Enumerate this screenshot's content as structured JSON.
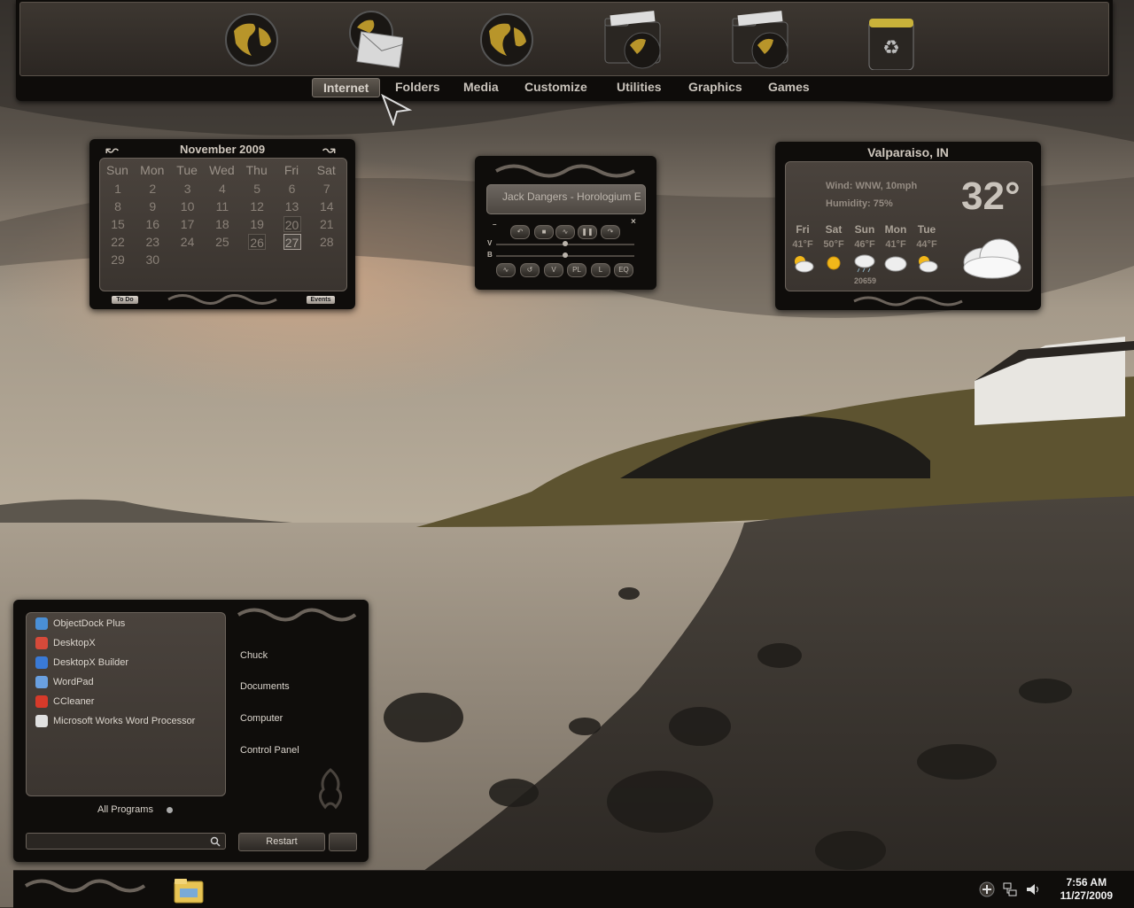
{
  "dock": {
    "tabs": [
      {
        "label": "Internet",
        "active": true
      },
      {
        "label": "Folders"
      },
      {
        "label": "Media"
      },
      {
        "label": "Customize"
      },
      {
        "label": "Utilities"
      },
      {
        "label": "Graphics"
      },
      {
        "label": "Games"
      }
    ],
    "icons": [
      "globe-icon",
      "mail-icon",
      "globe-icon",
      "folder-globe-icon",
      "folder-globe-icon",
      "recycle-bin-icon"
    ]
  },
  "calendar": {
    "month_title": "November 2009",
    "weekdays": [
      "Sun",
      "Mon",
      "Tue",
      "Wed",
      "Thu",
      "Fri",
      "Sat"
    ],
    "weeks": [
      [
        "1",
        "2",
        "3",
        "4",
        "5",
        "6",
        "7"
      ],
      [
        "8",
        "9",
        "10",
        "11",
        "12",
        "13",
        "14"
      ],
      [
        "15",
        "16",
        "17",
        "18",
        "19",
        "20",
        "21"
      ],
      [
        "22",
        "23",
        "24",
        "25",
        "26",
        "27",
        "28"
      ],
      [
        "29",
        "30"
      ]
    ],
    "boxed_days": [
      "20",
      "26"
    ],
    "today": "27",
    "todo_label": "To Do",
    "events_label": "Events"
  },
  "player": {
    "track": "Jack Dangers - Horologium E",
    "v_label": "V",
    "b_label": "B",
    "close_label": "×",
    "min_label": "–",
    "buttons_row2": [
      "V",
      "PL",
      "L",
      "EQ"
    ],
    "volume": 0.5,
    "balance": 0.5
  },
  "weather": {
    "city": "Valparaiso, IN",
    "wind": "Wind: WNW, 10mph",
    "humidity": "Humidity: 75%",
    "temp": "32°",
    "forecast": [
      {
        "day": "Fri",
        "hi": "41°F",
        "icon": "partly-cloudy-icon"
      },
      {
        "day": "Sat",
        "hi": "50°F",
        "icon": "sunny-icon"
      },
      {
        "day": "Sun",
        "hi": "46°F",
        "icon": "rain-cloud-icon"
      },
      {
        "day": "Mon",
        "hi": "41°F",
        "icon": "cloudy-icon"
      },
      {
        "day": "Tue",
        "hi": "44°F",
        "icon": "partly-cloudy-icon"
      }
    ],
    "zip": "20659",
    "current_icon": "cloudy-icon"
  },
  "startmenu": {
    "programs": [
      {
        "label": "ObjectDock Plus",
        "color": "#4a8fd6"
      },
      {
        "label": "DesktopX",
        "color": "#d64a3a"
      },
      {
        "label": "DesktopX Builder",
        "color": "#3a7ad6"
      },
      {
        "label": "WordPad",
        "color": "#6aa0e0"
      },
      {
        "label": "CCleaner",
        "color": "#d63a2a"
      },
      {
        "label": "Microsoft Works Word Processor",
        "color": "#e0e0e0"
      }
    ],
    "places": [
      "Chuck",
      "Documents",
      "Computer",
      "Control Panel"
    ],
    "all_programs": "All Programs",
    "search_value": "",
    "restart_label": "Restart"
  },
  "taskbar": {
    "time": "7:56 AM",
    "date": "11/27/2009",
    "tray_icons": [
      "plus-icon",
      "network-icon",
      "volume-icon"
    ]
  }
}
